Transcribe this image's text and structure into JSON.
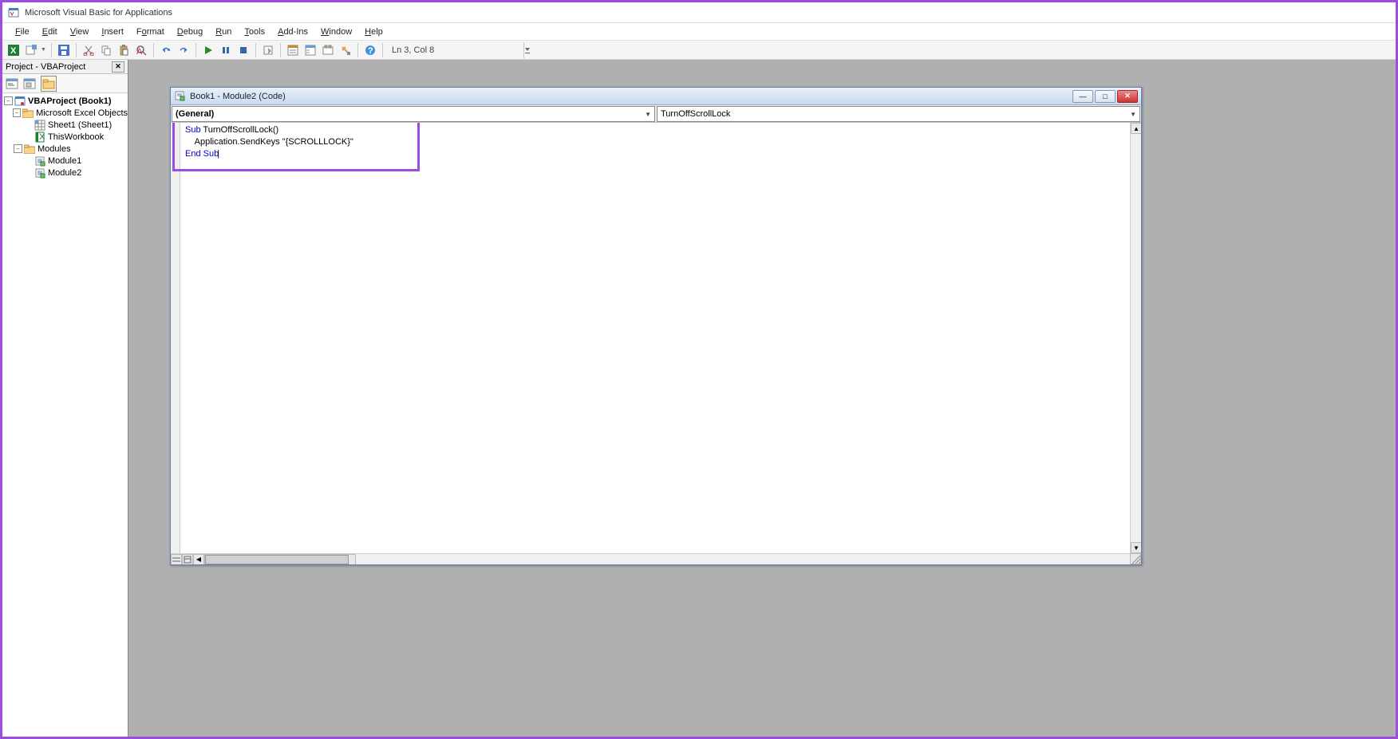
{
  "app": {
    "title": "Microsoft Visual Basic for Applications"
  },
  "menu": {
    "items": [
      "File",
      "Edit",
      "View",
      "Insert",
      "Format",
      "Debug",
      "Run",
      "Tools",
      "Add-Ins",
      "Window",
      "Help"
    ]
  },
  "toolbar": {
    "status": "Ln 3, Col 8"
  },
  "project_pane": {
    "title": "Project - VBAProject",
    "tree": {
      "root": "VBAProject (Book1)",
      "excel_objects_label": "Microsoft Excel Objects",
      "sheet1": "Sheet1 (Sheet1)",
      "thisworkbook": "ThisWorkbook",
      "modules_label": "Modules",
      "module1": "Module1",
      "module2": "Module2"
    }
  },
  "code_window": {
    "title": "Book1 - Module2 (Code)",
    "dropdown_object": "(General)",
    "dropdown_proc": "TurnOffScrollLock",
    "code": {
      "line1_kw": "Sub",
      "line1_rest": " TurnOffScrollLock()",
      "line2_indent": "    Application.SendKeys ",
      "line2_str": "\"{SCROLLLOCK}\"",
      "line3_kw": "End Sub"
    }
  }
}
